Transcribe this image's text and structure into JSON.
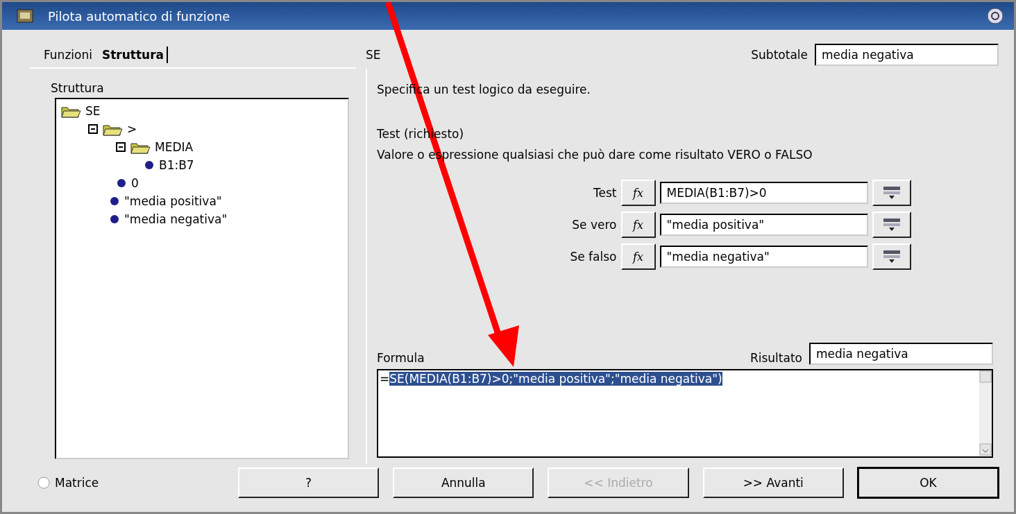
{
  "window": {
    "title": "Pilota automatico di funzione"
  },
  "tabs": [
    {
      "label": "Funzioni",
      "selected": false
    },
    {
      "label": "Struttura",
      "selected": true
    }
  ],
  "structure": {
    "label": "Struttura",
    "tree": [
      {
        "label": "SE",
        "kind": "folder",
        "children": [
          {
            "label": ">",
            "kind": "folder",
            "expanded": true,
            "children": [
              {
                "label": "MEDIA",
                "kind": "folder",
                "expanded": true,
                "children": [
                  {
                    "label": "B1:B7",
                    "kind": "value"
                  }
                ]
              },
              {
                "label": "0",
                "kind": "value"
              }
            ]
          },
          {
            "label": "\"media positiva\"",
            "kind": "value"
          },
          {
            "label": "\"media negativa\"",
            "kind": "value"
          }
        ]
      }
    ]
  },
  "function": {
    "name": "SE",
    "subtotal_label": "Subtotale",
    "subtotal": "media negativa",
    "description": "Specifica un test logico da eseguire.",
    "argument_title": "Test (richiesto)",
    "argument_description": "Valore o espressione qualsiasi che può dare come risultato VERO o FALSO"
  },
  "arguments": [
    {
      "label": "Test",
      "fx": "fx",
      "value": "MEDIA(B1:B7)>0"
    },
    {
      "label": "Se vero",
      "fx": "fx",
      "value": "\"media positiva\""
    },
    {
      "label": "Se falso",
      "fx": "fx",
      "value": "\"media negativa\""
    }
  ],
  "formula": {
    "label": "Formula",
    "result_label": "Risultato",
    "result": "media negativa",
    "sign": "=",
    "body": "SE(MEDIA(B1:B7)>0;\"media positiva\";\"media negativa\")",
    "body_selected": true
  },
  "matrix": {
    "label": "Matrice",
    "checked": false
  },
  "buttons": [
    {
      "label": "?",
      "disabled": false,
      "default": false
    },
    {
      "label": "Annulla",
      "disabled": false,
      "default": false
    },
    {
      "label": "<< Indietro",
      "disabled": true,
      "default": false
    },
    {
      "label": ">> Avanti",
      "disabled": false,
      "default": false
    },
    {
      "label": "OK",
      "disabled": false,
      "default": true
    }
  ]
}
